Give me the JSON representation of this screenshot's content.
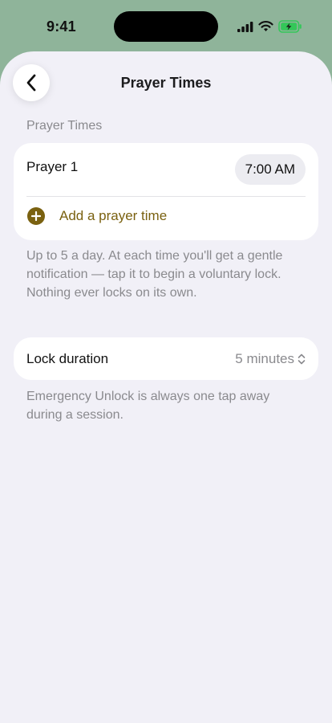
{
  "status_bar": {
    "time": "9:41",
    "signal_icon": "cellular-signal-icon",
    "wifi_icon": "wifi-icon",
    "battery_icon": "battery-charging-icon",
    "battery_color": "#34c759"
  },
  "nav": {
    "title": "Prayer Times",
    "back_icon": "chevron-left-icon"
  },
  "section": {
    "header": "Prayer Times"
  },
  "prayers": [
    {
      "label": "Prayer 1",
      "time": "7:00 AM"
    }
  ],
  "add_prayer": {
    "label": "Add a prayer time",
    "icon": "plus-circle-icon",
    "accent_color": "#7a6110"
  },
  "footnote_prayers": "Up to 5 a day. At each time you'll get a gentle notification — tap it to begin a voluntary lock. Nothing ever locks on its own.",
  "lock_duration": {
    "label": "Lock duration",
    "value": "5 minutes",
    "icon": "up-down-chevron-icon"
  },
  "footnote_lock": "Emergency Unlock is always one tap away during a session.",
  "colors": {
    "header_background": "#8fb49a",
    "sheet_background": "#f1f0f7",
    "card_background": "#ffffff"
  }
}
